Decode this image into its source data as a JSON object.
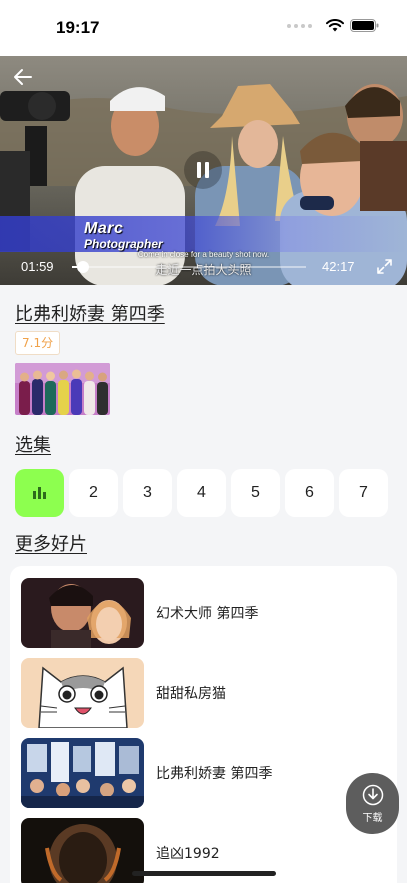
{
  "status_bar": {
    "time": "19:17"
  },
  "player": {
    "overlay_name": "Marc",
    "overlay_role": "Photographer",
    "subtitle_en": "Come in close for a beauty shot now.",
    "subtitle_zh": "走近一点拍大头照",
    "current_time": "01:59",
    "total_time": "42:17",
    "progress": 0.047
  },
  "show": {
    "title": "比弗利娇妻 第四季",
    "rating": "7.1分"
  },
  "episodes": {
    "label": "选集",
    "items": [
      "2",
      "3",
      "4",
      "5",
      "6",
      "7"
    ]
  },
  "more": {
    "label": "更多好片",
    "items": [
      {
        "title": "幻术大师 第四季"
      },
      {
        "title": "甜甜私房猫"
      },
      {
        "title": "比弗利娇妻 第四季"
      },
      {
        "title": "追凶1992"
      }
    ]
  },
  "download": {
    "label": "下载"
  }
}
